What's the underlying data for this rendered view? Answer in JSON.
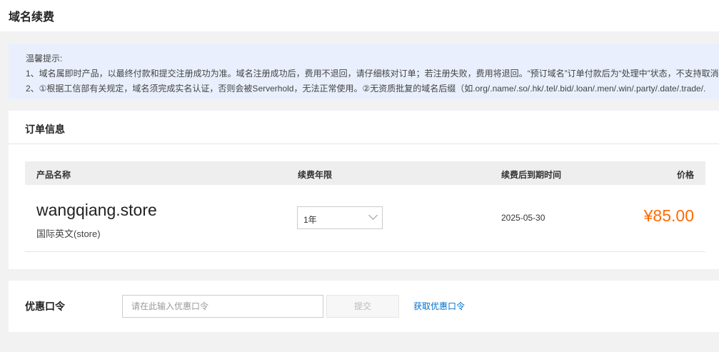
{
  "header": {
    "title": "域名续费"
  },
  "notice": {
    "title": "温馨提示:",
    "line1": "1、域名属即时产品，以最终付款和提交注册成功为准。域名注册成功后，费用不退回，请仔细核对订单；若注册失败，费用将退回。“预订域名”订单付款后为“处理中”状态，不支持取消",
    "line2": "2、①根据工信部有关规定，域名须完成实名认证，否则会被Serverhold，无法正常使用。②无资质批复的域名后缀（如.org/.name/.so/.hk/.tel/.bid/.loan/.men/.win/.party/.date/.trade/."
  },
  "order": {
    "title": "订单信息",
    "columns": [
      "产品名称",
      "续费年限",
      "续费后到期时间",
      "价格"
    ],
    "item": {
      "domain": "wangqiang.store",
      "type": "国际英文(store)",
      "years": "1年",
      "expiry": "2025-05-30",
      "price": "¥85.00"
    }
  },
  "coupon": {
    "label": "优惠口令",
    "placeholder": "请在此输入优惠口令",
    "submit": "提交",
    "get_link": "获取优惠口令"
  }
}
